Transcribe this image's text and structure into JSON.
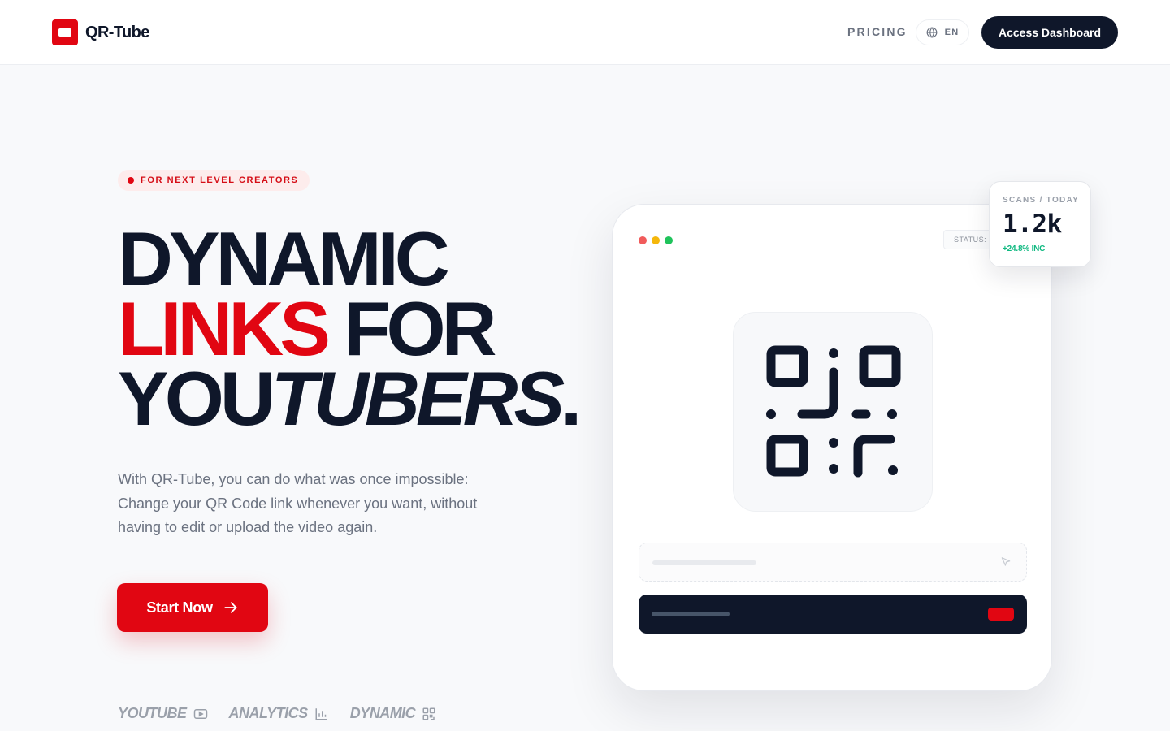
{
  "header": {
    "logo_text": "QR-Tube",
    "logo_icon": "logo-mark-icon",
    "nav_pricing": "PRICING",
    "language": "EN",
    "language_icon": "globe-icon",
    "dashboard_button": "Access Dashboard"
  },
  "hero": {
    "badge": "FOR NEXT LEVEL CREATORS",
    "headline": {
      "line1": "DYNAMIC",
      "line2_red": "LINKS",
      "line2_rest": " FOR",
      "line3_plain": "YOU",
      "line3_italic": "TUBERS",
      "line3_end": "."
    },
    "lead": "With QR-Tube, you can do what was once impossible: Change your QR Code link whenever you want, without having to edit or upload the video again.",
    "cta": "Start Now",
    "cta_icon": "arrow-right-icon"
  },
  "features": [
    {
      "label": "YOUTUBE",
      "icon": "play-icon"
    },
    {
      "label": "ANALYTICS",
      "icon": "bar-chart-icon"
    },
    {
      "label": "DYNAMIC",
      "icon": "qr-code-icon"
    }
  ],
  "mockup": {
    "status_label": "STATUS:",
    "traffic_colors": [
      "#f15b5b",
      "#f5b70b",
      "#1fc35b"
    ]
  },
  "stat_card": {
    "label": "SCANS / TODAY",
    "value": "1.2k",
    "change": "+24.8% INC"
  },
  "colors": {
    "brand_red": "#e10612",
    "navy": "#0f172a",
    "success": "#10b981"
  }
}
